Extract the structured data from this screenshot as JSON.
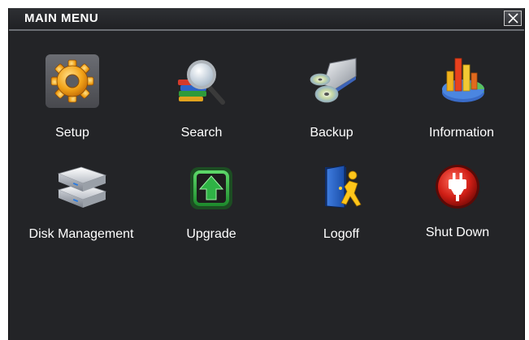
{
  "window": {
    "title": "MAIN MENU"
  },
  "icons": {
    "close": "close-icon"
  },
  "menu": {
    "items": [
      {
        "id": "setup",
        "label": "Setup",
        "icon": "gear-icon"
      },
      {
        "id": "search",
        "label": "Search",
        "icon": "magnifier-books-icon"
      },
      {
        "id": "backup",
        "label": "Backup",
        "icon": "disc-drive-icon"
      },
      {
        "id": "information",
        "label": "Information",
        "icon": "pie-chart-icon"
      },
      {
        "id": "disk-management",
        "label": "Disk Management",
        "icon": "hard-disk-icon"
      },
      {
        "id": "upgrade",
        "label": "Upgrade",
        "icon": "upgrade-arrow-icon"
      },
      {
        "id": "logoff",
        "label": "Logoff",
        "icon": "logoff-door-icon"
      },
      {
        "id": "shut-down",
        "label": "Shut Down",
        "icon": "power-plug-icon"
      }
    ]
  },
  "colors": {
    "background": "#232427",
    "title_text": "#ffffff",
    "label_text": "#ffffff",
    "setup_frame": "#5b5d62"
  }
}
